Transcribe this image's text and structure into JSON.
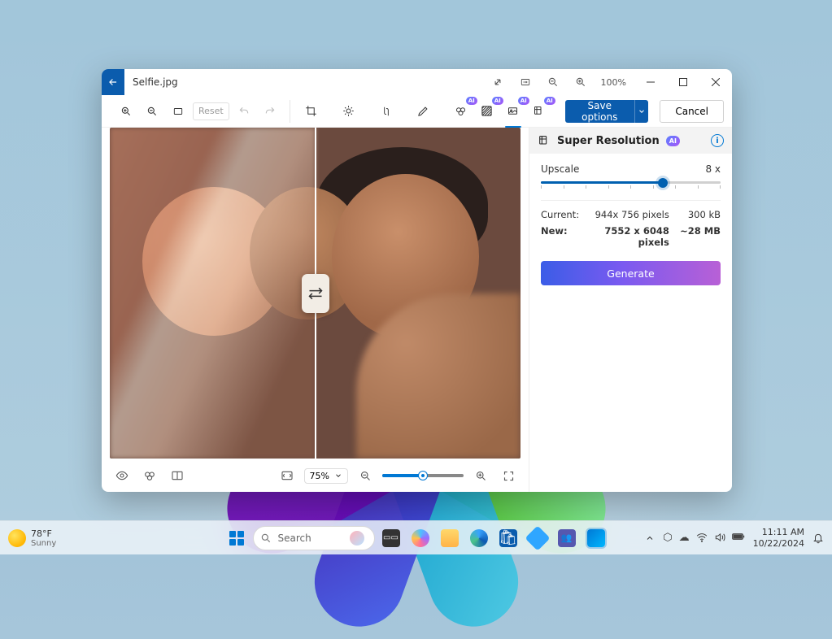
{
  "window": {
    "filename": "Selfie.jpg",
    "titlebar_zoom": "100%",
    "save_label": "Save options",
    "cancel_label": "Cancel",
    "reset_label": "Reset"
  },
  "canvas": {
    "zoom_label": "75%"
  },
  "panel": {
    "title": "Super Resolution",
    "ai_badge": "AI",
    "upscale_label": "Upscale",
    "upscale_value": "8 x",
    "current_label": "Current:",
    "current_dim": "944x 756 pixels",
    "current_size": "300 kB",
    "new_label": "New:",
    "new_dim": "7552 x 6048 pixels",
    "new_size": "~28 MB",
    "generate_label": "Generate"
  },
  "taskbar": {
    "temp": "78°F",
    "condition": "Sunny",
    "search_placeholder": "Search",
    "time": "11:11 AM",
    "date": "10/22/2024"
  }
}
